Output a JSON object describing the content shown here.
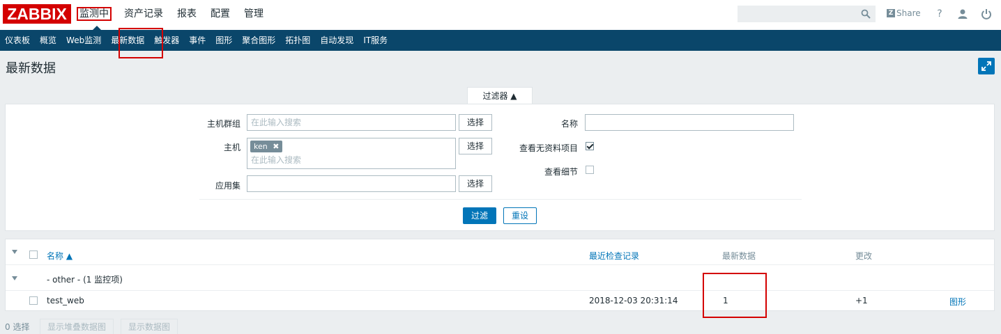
{
  "header": {
    "logo": "ZABBIX",
    "menu": [
      "监测中",
      "资产记录",
      "报表",
      "配置",
      "管理"
    ],
    "share_label": "Share",
    "help_glyph": "?"
  },
  "submenu": [
    "仪表板",
    "概览",
    "Web监测",
    "最新数据",
    "触发器",
    "事件",
    "图形",
    "聚合图形",
    "拓扑图",
    "自动发现",
    "IT服务"
  ],
  "page": {
    "title": "最新数据"
  },
  "filter": {
    "tab_label": "过滤器 ▲",
    "hostgroup_label": "主机群组",
    "hostgroup_placeholder": "在此输入搜索",
    "host_label": "主机",
    "host_tag": "ken",
    "host_placeholder": "在此输入搜索",
    "application_label": "应用集",
    "select_label": "选择",
    "name_label": "名称",
    "show_no_data_label": "查看无资料项目",
    "show_no_data_checked": true,
    "show_details_label": "查看细节",
    "show_details_checked": false,
    "apply_label": "过滤",
    "reset_label": "重设"
  },
  "table": {
    "headers": {
      "name": "名称 ▲",
      "last_check": "最近检查记录",
      "last_value": "最新数据",
      "change": "更改"
    },
    "group_row": {
      "label": "- other - (1 监控项)"
    },
    "rows": [
      {
        "name": "test_web",
        "last_check": "2018-12-03 20:31:14",
        "last_value": "1",
        "change": "+1",
        "action": "图形"
      }
    ]
  },
  "footer": {
    "selected": "0 选择",
    "stacked_graph": "显示堆叠数据图",
    "graph": "显示数据图"
  }
}
